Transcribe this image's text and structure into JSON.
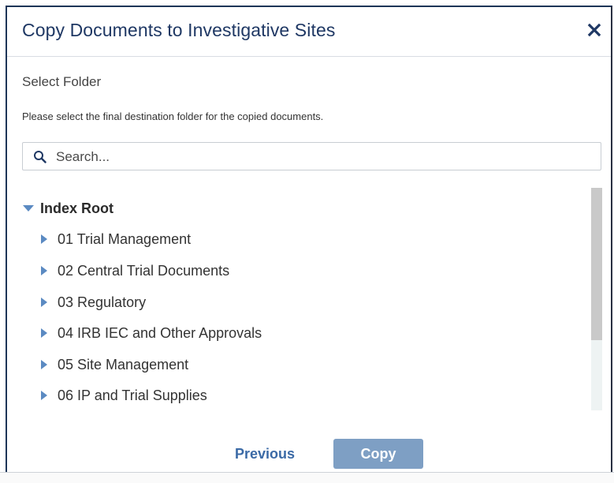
{
  "dialog": {
    "title": "Copy Documents to Investigative Sites",
    "close_icon": "close-icon",
    "section_title": "Select Folder",
    "instructions": "Please select the final destination folder for the copied documents."
  },
  "search": {
    "placeholder": "Search...",
    "value": "",
    "icon": "search-icon"
  },
  "tree": {
    "root": {
      "label": "Index Root",
      "expanded": true
    },
    "items": [
      {
        "label": "01 Trial Management"
      },
      {
        "label": "02 Central Trial Documents"
      },
      {
        "label": "03 Regulatory"
      },
      {
        "label": "04 IRB IEC and Other Approvals"
      },
      {
        "label": "05 Site Management"
      },
      {
        "label": "06 IP and Trial Supplies"
      }
    ]
  },
  "footer": {
    "previous_label": "Previous",
    "copy_label": "Copy"
  },
  "colors": {
    "title": "#1f3864",
    "accent": "#3b6aa6",
    "copy_button": "#7e9fc4",
    "caret": "#5b8ac2"
  }
}
